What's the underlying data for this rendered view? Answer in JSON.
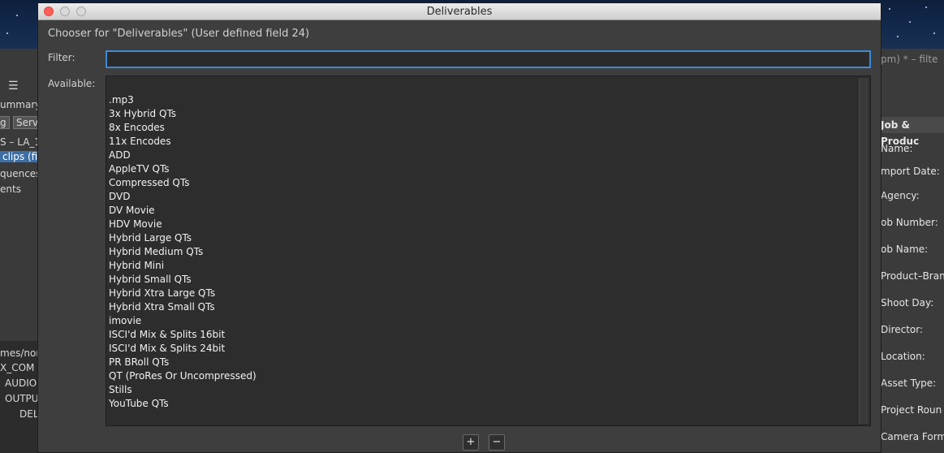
{
  "window": {
    "title": "Deliverables"
  },
  "chooser": {
    "title": "Chooser for \"Deliverables\" (User defined field 24)"
  },
  "filter": {
    "label": "Filter:",
    "value": "",
    "placeholder": ""
  },
  "available": {
    "label": "Available:",
    "items": [
      ".mp3",
      "3x Hybrid QTs",
      "8x Encodes",
      "11x Encodes",
      "ADD",
      "AppleTV QTs",
      "Compressed QTs",
      "DVD",
      "DV Movie",
      "HDV Movie",
      "Hybrid Large QTs",
      "Hybrid Medium QTs",
      "Hybrid Mini",
      "Hybrid Small QTs",
      "Hybrid Xtra Large QTs",
      "Hybrid Xtra Small QTs",
      "imovie",
      "ISCI'd Mix & Splits 16bit",
      "ISCI'd Mix & Splits 24bit",
      "PR BRoll QTs",
      "QT (ProRes Or Uncompressed)",
      "Stills",
      "YouTube QTs"
    ]
  },
  "buttons": {
    "add": "+",
    "remove": "−"
  },
  "background_left": {
    "menu_icon": "list-icon",
    "summary": "ummary",
    "tab1": "g",
    "tab2": "Serv",
    "path": "S – LA_1",
    "selected": "clips (fi",
    "sequences": "quences",
    "events": "ents",
    "lower1": "mes/non",
    "lower2": "X_COM",
    "lower3": "AUDIO",
    "lower4": "OUTPU",
    "lower5": "DEL"
  },
  "background_right": {
    "title": "pm) * – filte",
    "section": "Job & Produc",
    "fields": [
      "Name:",
      "mport Date:",
      "Agency:",
      "ob Number:",
      "ob Name:",
      "Product–Bran",
      "Shoot Day:",
      "Director:",
      "Location:",
      "Asset Type:",
      "Project Roun",
      "Camera Form"
    ]
  }
}
